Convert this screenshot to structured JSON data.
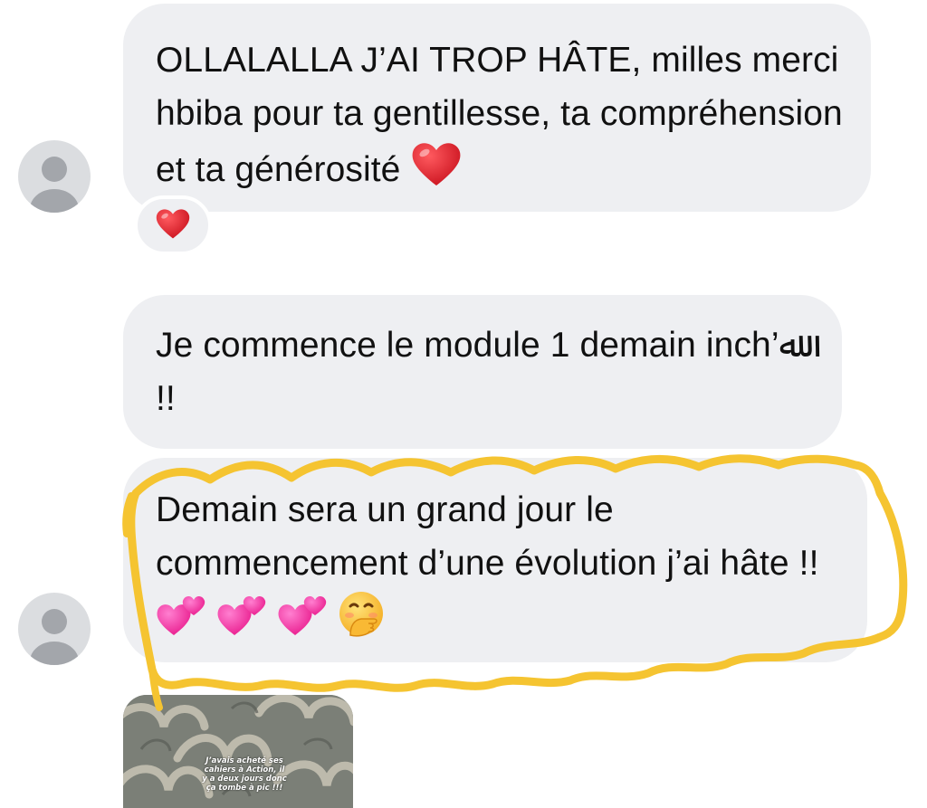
{
  "conversation": {
    "messages": [
      {
        "sender": "other",
        "text": "OLLALALLA J’AI TROP HÂTE, milles merci hbiba pour ta gentillesse, ta compréhension et ta générosité",
        "trailing_emojis": [
          "heart-emoji"
        ],
        "reaction": "heart-emoji"
      },
      {
        "sender": "other",
        "text": "Je commence le module 1 demain inch’ﷲ !!"
      },
      {
        "sender": "other",
        "text": "Demain sera un grand jour le commencement d’une évolution j’ai hâte !!",
        "trailing_emojis": [
          "two-hearts-emoji",
          "two-hearts-emoji",
          "two-hearts-emoji",
          "face-with-hand-over-mouth-emoji"
        ],
        "highlighted": true
      },
      {
        "sender": "other",
        "type": "story-reply-image",
        "caption": "J’avais acheté ses cahiers à Action, il y a deux jours donc ça tombe à pic !!!"
      }
    ]
  },
  "colors": {
    "background": "#ffffff",
    "bubble": "#eeeff2",
    "text": "#111111",
    "avatar_bg": "#dbdde0",
    "avatar_fg": "#a3a6ab",
    "highlight_annotation": "#f5c431",
    "heart": "#e0242b",
    "pink_hearts": "#ff2da0"
  }
}
